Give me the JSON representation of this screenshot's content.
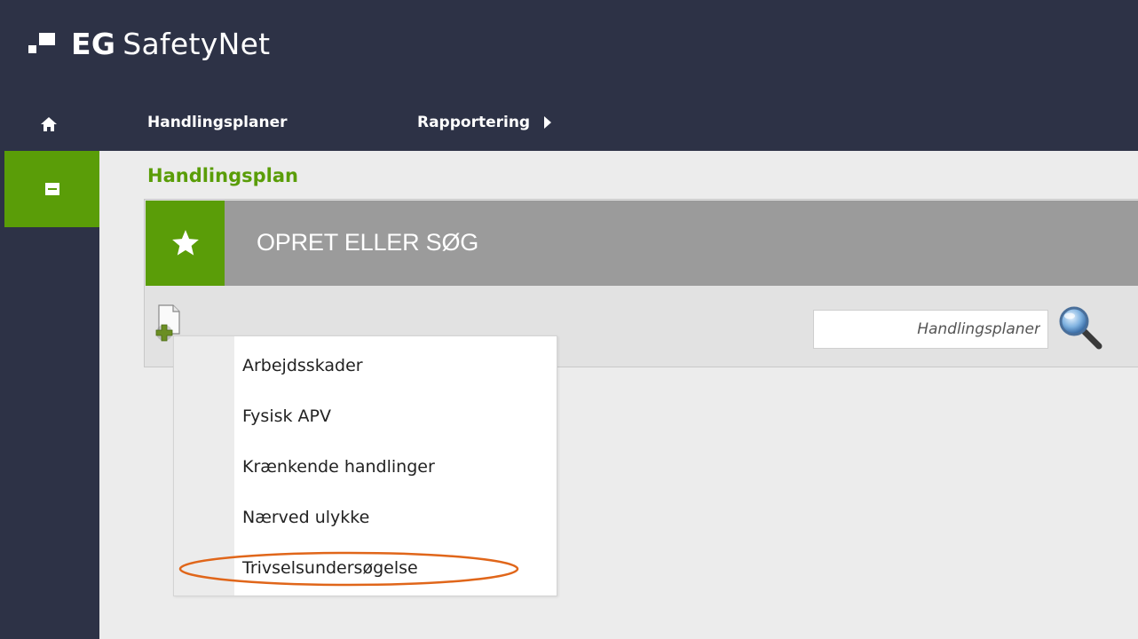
{
  "app": {
    "logo_bold": "EG",
    "logo_name": "SafetyNet"
  },
  "nav": {
    "home_icon": "home-icon",
    "items": [
      {
        "label": "Handlingsplaner"
      },
      {
        "label": "Rapportering",
        "has_submenu": true
      }
    ]
  },
  "sidebar": {
    "active_icon": "list-icon"
  },
  "page": {
    "title": "Handlingsplan"
  },
  "panel": {
    "title": "OPRET ELLER SØG",
    "star_icon": "star-icon",
    "new_icon": "new-document-icon",
    "search_placeholder": "Handlingsplaner",
    "search_icon": "magnifier-icon"
  },
  "menu": {
    "items": [
      {
        "label": "Arbejdsskader"
      },
      {
        "label": "Fysisk APV"
      },
      {
        "label": "Krænkende handlinger"
      },
      {
        "label": "Nærved ulykke"
      },
      {
        "label": "Trivselsundersøgelse",
        "highlighted": true
      }
    ]
  },
  "colors": {
    "dark_navy": "#2d3246",
    "green": "#5a9d08",
    "header_gray": "#9b9b9b",
    "highlight_orange": "#e0661a"
  }
}
